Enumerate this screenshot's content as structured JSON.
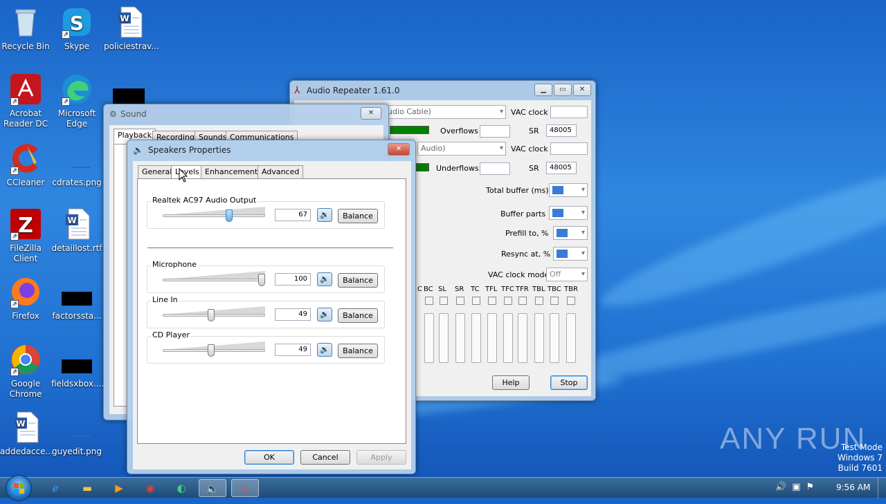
{
  "desktop": {
    "icons": [
      {
        "label": "Recycle Bin"
      },
      {
        "label": "Skype"
      },
      {
        "label": "policiestrav..."
      },
      {
        "label": "Acrobat Reader DC"
      },
      {
        "label": "Microsoft Edge"
      },
      {
        "label": "CCleaner"
      },
      {
        "label": "cdrates.png"
      },
      {
        "label": "FileZilla Client"
      },
      {
        "label": "detaillost.rtf"
      },
      {
        "label": "Firefox"
      },
      {
        "label": "factorssta..."
      },
      {
        "label": "Google Chrome"
      },
      {
        "label": "fieldsxbox...."
      },
      {
        "label": "addedacce..."
      },
      {
        "label": "guyedit.png"
      }
    ],
    "watermark": "ANY RUN",
    "test_mode": [
      "Test Mode",
      "Windows 7",
      "Build 7601"
    ]
  },
  "audio_repeater": {
    "title": "Audio Repeater 1.61.0",
    "input_device": "udio Cable)",
    "output_device": "Audio)",
    "vac_clock_label": "VAC clock",
    "overflows_label": "Overflows",
    "underflows_label": "Underflows",
    "sr_label": "SR",
    "sr_in": "48005",
    "sr_out": "48005",
    "total_buffer_label": "Total buffer (ms)",
    "buffer_parts_label": "Buffer parts",
    "prefill_label": "Prefill to, %",
    "resync_label": "Resync at, %",
    "vac_clock_mode_label": "VAC clock mode",
    "vac_clock_mode_value": "Off",
    "channels": [
      "C",
      "BC",
      "SL",
      "SR",
      "TC",
      "TFL",
      "TFC",
      "TFR",
      "TBL",
      "TBC",
      "TBR"
    ],
    "help_label": "Help",
    "stop_label": "Stop"
  },
  "sound": {
    "title": "Sound",
    "tabs": [
      "Playback",
      "Recording",
      "Sounds",
      "Communications"
    ]
  },
  "speakers": {
    "title": "Speakers Properties",
    "tabs": [
      "General",
      "Levels",
      "Enhancements",
      "Advanced"
    ],
    "active_tab": "Levels",
    "levels": [
      {
        "name": "Realtek AC97 Audio Output",
        "value": "67",
        "level": 67
      },
      {
        "name": "Microphone",
        "value": "100",
        "level": 100
      },
      {
        "name": "Line In",
        "value": "49",
        "level": 49
      },
      {
        "name": "CD Player",
        "value": "49",
        "level": 49
      }
    ],
    "balance_label": "Balance",
    "ok_label": "OK",
    "cancel_label": "Cancel",
    "apply_label": "Apply"
  },
  "taskbar": {
    "clock": "9:56 AM"
  }
}
